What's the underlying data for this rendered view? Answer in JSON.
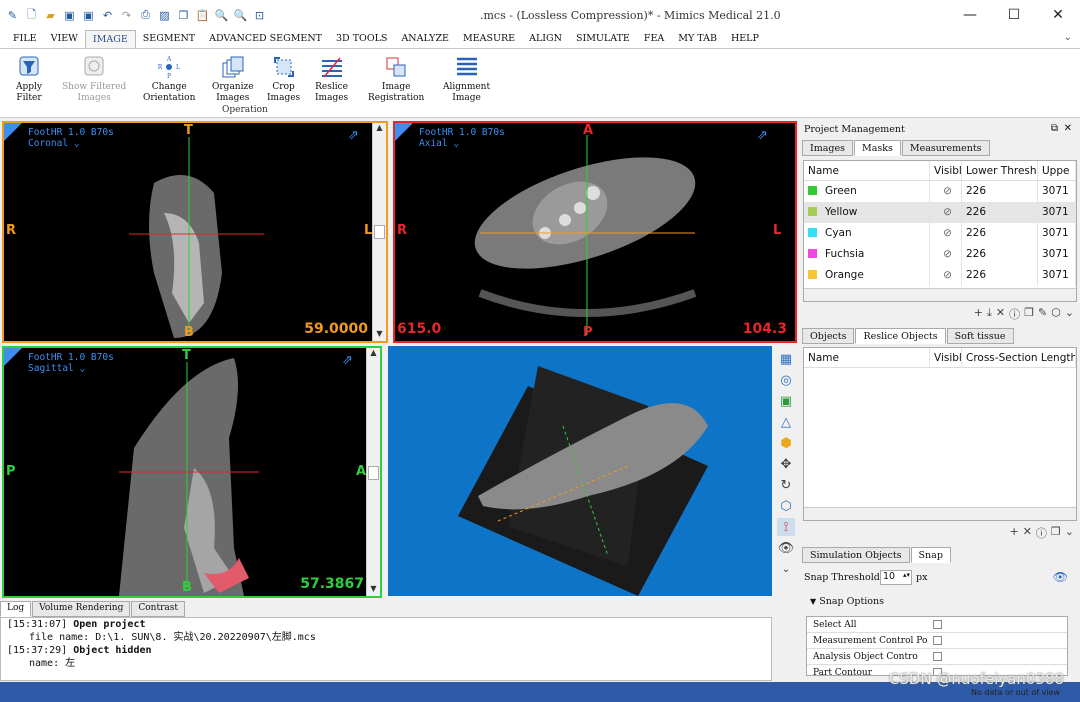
{
  "window": {
    "title": ".mcs - (Lossless Compression)* - Mimics Medical 21.0",
    "controls": [
      "minimize-icon",
      "maximize-icon",
      "close-icon"
    ]
  },
  "quick_access": [
    "logo-icon",
    "new-icon",
    "open-icon",
    "save-icon",
    "save-as-icon",
    "undo-icon",
    "redo-icon",
    "print-icon",
    "screenshot-icon",
    "copy-icon",
    "paste-icon",
    "zoom-in-icon",
    "zoom-out-icon",
    "fit-icon"
  ],
  "menu": {
    "items": [
      "FILE",
      "VIEW",
      "IMAGE",
      "SEGMENT",
      "ADVANCED SEGMENT",
      "3D TOOLS",
      "ANALYZE",
      "MEASURE",
      "ALIGN",
      "SIMULATE",
      "FEA",
      "MY TAB",
      "HELP"
    ],
    "active": "IMAGE"
  },
  "ribbon": {
    "buttons": [
      {
        "label1": "Apply",
        "label2": "Filter",
        "icon": "apply-filter-icon",
        "enabled": true
      },
      {
        "label1": "Show Filtered",
        "label2": "Images",
        "icon": "show-filtered-icon",
        "enabled": false
      },
      {
        "label1": "Change",
        "label2": "Orientation",
        "icon": "orientation-icon",
        "enabled": true
      },
      {
        "label1": "Organize",
        "label2": "Images",
        "icon": "organize-icon",
        "enabled": true
      },
      {
        "label1": "Crop",
        "label2": "Images",
        "icon": "crop-icon",
        "enabled": true
      },
      {
        "label1": "Reslice",
        "label2": "Images",
        "icon": "reslice-icon",
        "enabled": true
      },
      {
        "label1": "Image",
        "label2": "Registration",
        "icon": "registration-icon",
        "enabled": true
      },
      {
        "label1": "Alignment",
        "label2": "Image",
        "icon": "alignment-icon",
        "enabled": true
      }
    ],
    "group_label": "Operation",
    "orientation_letters": {
      "a": "A",
      "r": "R",
      "l": "L",
      "p": "P"
    }
  },
  "viewports": {
    "coronal": {
      "series": "FootHR  1.0  B70s",
      "view": "Coronal",
      "top": "T",
      "bottom": "B",
      "left": "R",
      "right": "L",
      "value": "59.0000",
      "color": "#f39a1e"
    },
    "axial": {
      "series": "FootHR  1.0  B70s",
      "view": "Axial",
      "top": "A",
      "bottom": "P",
      "left": "R",
      "right": "L",
      "value_left": "615.0",
      "value_right": "104.3",
      "color": "#e8262a"
    },
    "sagittal": {
      "series": "FootHR  1.0  B70s",
      "view": "Sagittal",
      "top": "T",
      "bottom": "B",
      "left": "P",
      "right": "A",
      "value": "57.3867",
      "color": "#2fcf3c"
    }
  },
  "project": {
    "title": "Project Management",
    "tabs": [
      "Images",
      "Masks",
      "Measurements"
    ],
    "active_tab": "Masks",
    "mask_columns": [
      "Name",
      "Visibl",
      "Lower Thresho",
      "Uppe"
    ],
    "masks": [
      {
        "name": "Green",
        "color": "#35c837",
        "lower": "226",
        "upper": "3071"
      },
      {
        "name": "Yellow",
        "color": "#a4cc53",
        "lower": "226",
        "upper": "3071"
      },
      {
        "name": "Cyan",
        "color": "#33dff2",
        "lower": "226",
        "upper": "3071"
      },
      {
        "name": "Fuchsia",
        "color": "#f246e0",
        "lower": "226",
        "upper": "3071"
      },
      {
        "name": "Orange",
        "color": "#f7c631",
        "lower": "226",
        "upper": "3071"
      }
    ],
    "object_tabs": [
      "Objects",
      "Reslice Objects",
      "Soft tissue"
    ],
    "active_object_tab": "Reslice Objects",
    "object_columns": [
      "Name",
      "Visibl",
      "Cross-Section Length ("
    ],
    "sim_tabs": [
      "Simulation Objects",
      "Snap"
    ],
    "active_sim_tab": "Snap",
    "snap_threshold_label": "Snap Threshold",
    "snap_threshold_value": "10",
    "snap_unit": "px",
    "snap_options_label": "Snap Options",
    "snap_options": [
      "Select All",
      "Measurement Control Po",
      "Analysis Object Contro",
      "Part Contour"
    ]
  },
  "log": {
    "tabs": [
      "Log",
      "Volume Rendering",
      "Contrast"
    ],
    "active": "Log",
    "lines": [
      {
        "time": "[15:31:07]",
        "text": "Open project"
      },
      {
        "sub": "file name: D:\\1. SUN\\8. 实战\\20.20220907\\左脚.mcs"
      },
      {
        "time": "[15:37:29]",
        "text": "Object hidden"
      },
      {
        "sub": "name: 左"
      }
    ]
  },
  "status": {
    "text": "No data or out of view"
  },
  "watermark": "CSDN @nuofeiyan0388"
}
